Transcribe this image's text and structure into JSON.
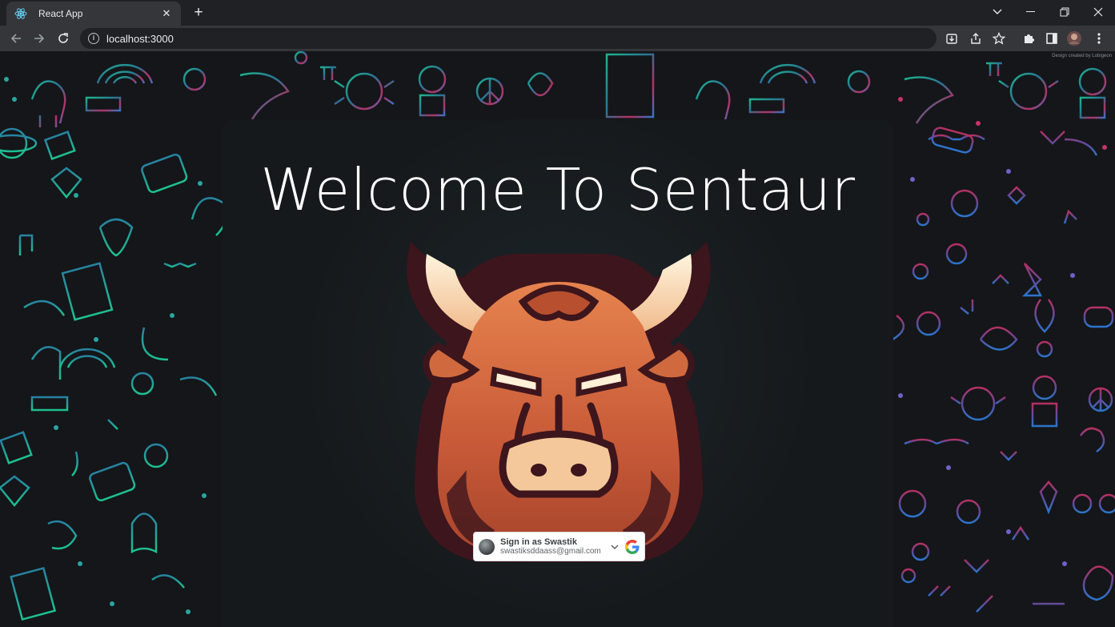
{
  "browser": {
    "tab_title": "React App",
    "url": "localhost:3000",
    "icons": [
      "react-icon",
      "close-icon",
      "plus-icon",
      "chevron-down-icon",
      "minimize-icon",
      "restore-icon",
      "window-close-icon",
      "back-icon",
      "forward-icon",
      "reload-icon",
      "info-icon",
      "install-icon",
      "share-icon",
      "star-icon",
      "extensions-icon",
      "side-panel-icon",
      "profile-avatar",
      "kebab-menu-icon"
    ]
  },
  "page": {
    "background_credit": "Design created by Lobigeon",
    "title": "Welcome To Sentaur",
    "logo": "bull-logo",
    "colors": {
      "accent_teal": "#1fc59a",
      "accent_pink": "#c7336b",
      "accent_blue": "#3b7fd9",
      "bull_orange": "#d96a3f",
      "bull_outline": "#4a1a22"
    }
  },
  "google_signin": {
    "label": "Sign in as Swastik",
    "email": "swastiksddaass@gmail.com",
    "icons": [
      "avatar",
      "chevron-down-icon",
      "google-g-icon"
    ]
  }
}
